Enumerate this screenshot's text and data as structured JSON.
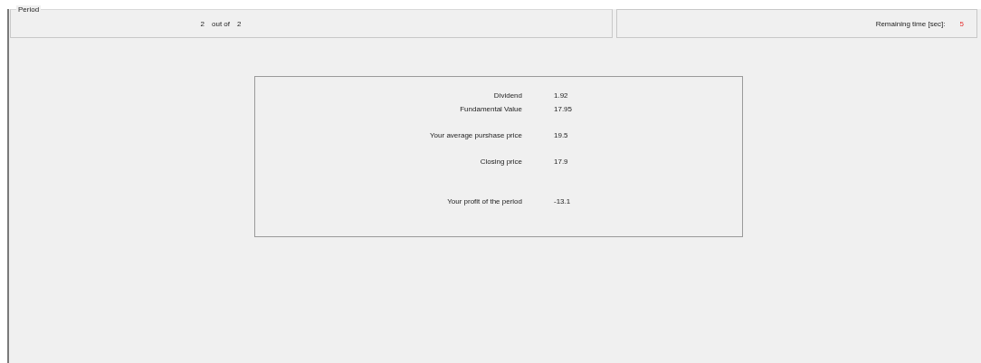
{
  "period": {
    "title": "Period",
    "current": "2",
    "separator": "out of",
    "total": "2"
  },
  "timer": {
    "label": "Remaining time [sec]:",
    "value": "5"
  },
  "summary": {
    "groups": [
      [
        {
          "label": "Dividend",
          "value": "1.92"
        },
        {
          "label": "Fundamental Value",
          "value": "17.95"
        }
      ],
      [
        {
          "label": "Your average purshase price",
          "value": "19.5"
        }
      ],
      [
        {
          "label": "Closing price",
          "value": "17.9"
        }
      ],
      [
        {
          "label": "Your profit of the period",
          "value": "-13.1"
        }
      ]
    ]
  }
}
